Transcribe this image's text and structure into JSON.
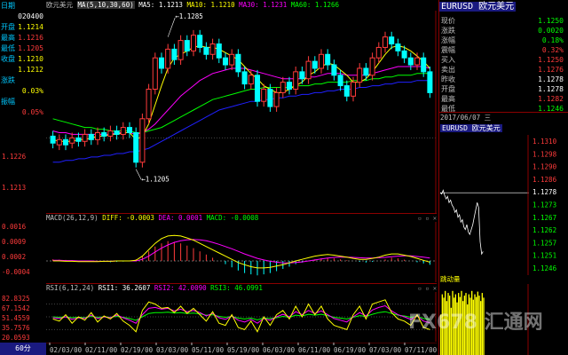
{
  "colors": {
    "bg": "#000000",
    "up": "#ff3b3b",
    "down": "#00ffff",
    "ma5": "#ffffff",
    "ma10": "#ffff00",
    "ma30": "#ff00ff",
    "ma60": "#00ff00",
    "ma_extra": "#2020ff",
    "label_cyan": "#00c8ff",
    "border_red": "#8b0000"
  },
  "left_panel": {
    "rows": [
      {
        "label": "日期",
        "value": "",
        "color": "#00c8ff"
      },
      {
        "label": "",
        "value": "020400",
        "color": "#ffffff"
      },
      {
        "label": "开盘",
        "value": "1.1214",
        "color": "#ffff00"
      },
      {
        "label": "最高",
        "value": "1.1216",
        "color": "#ff3b3b"
      },
      {
        "label": "最低",
        "value": "1.1205",
        "color": "#ff3b3b"
      },
      {
        "label": "收盘",
        "value": "1.1210",
        "color": "#ffff00"
      },
      {
        "label": "",
        "value": "1.1212",
        "color": "#ffff00"
      },
      {
        "label": "涨跌",
        "value": "",
        "color": "#00c8ff"
      },
      {
        "label": "",
        "value": "0.03%",
        "color": "#ffff00"
      },
      {
        "label": "振幅",
        "value": "",
        "color": "#00c8ff"
      },
      {
        "label": "",
        "value": "0.05%",
        "color": "#ff3b3b"
      }
    ],
    "price_ticks": [
      "1.1226",
      "1.1213"
    ],
    "macd_ticks": [
      "0.0016",
      "0.0009",
      "0.0002",
      "-0.0004"
    ],
    "rsi_ticks": [
      "82.8325",
      "67.1542",
      "51.4559",
      "35.7576",
      "20.0593"
    ]
  },
  "main": {
    "header": {
      "symbol": "欧元美元",
      "ma_label": "MA(5,10,30,60)",
      "ma5": "MA5: 1.1213",
      "ma10": "MA10: 1.1210",
      "ma30": "MA30: 1.1231",
      "ma60": "MA60: 1.1266"
    },
    "annot_high": "1.1285",
    "annot_low": "1.1205",
    "chart_data": {
      "type": "candlestick",
      "candles": [
        {
          "o": 0.35,
          "c": 0.31
        },
        {
          "o": 0.3,
          "c": 0.33
        },
        {
          "o": 0.33,
          "c": 0.3
        },
        {
          "o": 0.31,
          "c": 0.34
        },
        {
          "o": 0.34,
          "c": 0.32
        },
        {
          "o": 0.32,
          "c": 0.36
        },
        {
          "o": 0.36,
          "c": 0.33
        },
        {
          "o": 0.33,
          "c": 0.37
        },
        {
          "o": 0.37,
          "c": 0.35
        },
        {
          "o": 0.35,
          "c": 0.38
        },
        {
          "o": 0.38,
          "c": 0.36
        },
        {
          "o": 0.36,
          "c": 0.4
        },
        {
          "o": 0.4,
          "c": 0.37
        },
        {
          "o": 0.37,
          "c": 0.2
        },
        {
          "o": 0.2,
          "c": 0.45
        },
        {
          "o": 0.45,
          "c": 0.62
        },
        {
          "o": 0.62,
          "c": 0.8
        },
        {
          "o": 0.8,
          "c": 0.74
        },
        {
          "o": 0.74,
          "c": 0.85
        },
        {
          "o": 0.85,
          "c": 0.79
        },
        {
          "o": 0.79,
          "c": 0.9
        },
        {
          "o": 0.9,
          "c": 0.84
        },
        {
          "o": 0.84,
          "c": 0.93
        },
        {
          "o": 0.93,
          "c": 0.86
        },
        {
          "o": 0.86,
          "c": 0.82
        },
        {
          "o": 0.82,
          "c": 0.88
        },
        {
          "o": 0.88,
          "c": 0.8
        },
        {
          "o": 0.8,
          "c": 0.76
        },
        {
          "o": 0.76,
          "c": 0.82
        },
        {
          "o": 0.82,
          "c": 0.72
        },
        {
          "o": 0.72,
          "c": 0.65
        },
        {
          "o": 0.65,
          "c": 0.7
        },
        {
          "o": 0.7,
          "c": 0.55
        },
        {
          "o": 0.55,
          "c": 0.62
        },
        {
          "o": 0.62,
          "c": 0.52
        },
        {
          "o": 0.52,
          "c": 0.6
        },
        {
          "o": 0.6,
          "c": 0.66
        },
        {
          "o": 0.66,
          "c": 0.62
        },
        {
          "o": 0.62,
          "c": 0.72
        },
        {
          "o": 0.72,
          "c": 0.68
        },
        {
          "o": 0.68,
          "c": 0.78
        },
        {
          "o": 0.78,
          "c": 0.74
        },
        {
          "o": 0.74,
          "c": 0.82
        },
        {
          "o": 0.82,
          "c": 0.76
        },
        {
          "o": 0.76,
          "c": 0.7
        },
        {
          "o": 0.7,
          "c": 0.64
        },
        {
          "o": 0.64,
          "c": 0.58
        },
        {
          "o": 0.58,
          "c": 0.66
        },
        {
          "o": 0.66,
          "c": 0.74
        },
        {
          "o": 0.74,
          "c": 0.7
        },
        {
          "o": 0.7,
          "c": 0.8
        },
        {
          "o": 0.8,
          "c": 0.86
        },
        {
          "o": 0.86,
          "c": 0.92
        },
        {
          "o": 0.92,
          "c": 0.88
        },
        {
          "o": 0.88,
          "c": 0.84
        },
        {
          "o": 0.84,
          "c": 0.8
        },
        {
          "o": 0.8,
          "c": 0.76
        },
        {
          "o": 0.76,
          "c": 0.8
        },
        {
          "o": 0.8,
          "c": 0.72
        },
        {
          "o": 0.72,
          "c": 0.6
        }
      ],
      "ma5": [
        0.33,
        0.32,
        0.32,
        0.32,
        0.33,
        0.33,
        0.34,
        0.35,
        0.35,
        0.36,
        0.36,
        0.37,
        0.37,
        0.33,
        0.35,
        0.42,
        0.53,
        0.64,
        0.74,
        0.8,
        0.82,
        0.84,
        0.86,
        0.87,
        0.86,
        0.86,
        0.85,
        0.83,
        0.81,
        0.79,
        0.75,
        0.71,
        0.68,
        0.64,
        0.62,
        0.6,
        0.6,
        0.62,
        0.64,
        0.66,
        0.7,
        0.72,
        0.75,
        0.77,
        0.76,
        0.73,
        0.7,
        0.66,
        0.66,
        0.68,
        0.72,
        0.77,
        0.82,
        0.86,
        0.87,
        0.86,
        0.84,
        0.81,
        0.78,
        0.74
      ],
      "ma30": [
        0.38,
        0.37,
        0.37,
        0.36,
        0.36,
        0.36,
        0.36,
        0.36,
        0.36,
        0.36,
        0.37,
        0.37,
        0.37,
        0.36,
        0.37,
        0.39,
        0.42,
        0.46,
        0.5,
        0.54,
        0.58,
        0.61,
        0.64,
        0.67,
        0.69,
        0.71,
        0.72,
        0.73,
        0.74,
        0.74,
        0.74,
        0.73,
        0.72,
        0.71,
        0.7,
        0.69,
        0.68,
        0.68,
        0.68,
        0.68,
        0.69,
        0.69,
        0.7,
        0.71,
        0.71,
        0.71,
        0.7,
        0.7,
        0.7,
        0.7,
        0.71,
        0.72,
        0.73,
        0.74,
        0.75,
        0.75,
        0.75,
        0.75,
        0.75,
        0.74
      ],
      "ma60": [
        0.45,
        0.44,
        0.43,
        0.42,
        0.41,
        0.4,
        0.4,
        0.39,
        0.39,
        0.38,
        0.38,
        0.38,
        0.38,
        0.37,
        0.37,
        0.38,
        0.39,
        0.4,
        0.42,
        0.44,
        0.46,
        0.48,
        0.5,
        0.52,
        0.54,
        0.56,
        0.57,
        0.58,
        0.59,
        0.6,
        0.61,
        0.62,
        0.62,
        0.63,
        0.63,
        0.63,
        0.63,
        0.63,
        0.64,
        0.64,
        0.64,
        0.65,
        0.65,
        0.66,
        0.66,
        0.66,
        0.66,
        0.67,
        0.67,
        0.67,
        0.68,
        0.68,
        0.69,
        0.69,
        0.7,
        0.7,
        0.7,
        0.71,
        0.71,
        0.71
      ],
      "maext": [
        0.2,
        0.2,
        0.21,
        0.21,
        0.22,
        0.22,
        0.23,
        0.23,
        0.24,
        0.24,
        0.25,
        0.25,
        0.26,
        0.26,
        0.27,
        0.28,
        0.3,
        0.32,
        0.34,
        0.36,
        0.38,
        0.4,
        0.42,
        0.44,
        0.46,
        0.48,
        0.5,
        0.51,
        0.52,
        0.53,
        0.54,
        0.55,
        0.55,
        0.56,
        0.56,
        0.57,
        0.57,
        0.58,
        0.58,
        0.59,
        0.59,
        0.6,
        0.6,
        0.61,
        0.61,
        0.62,
        0.62,
        0.62,
        0.63,
        0.63,
        0.64,
        0.64,
        0.65,
        0.65,
        0.66,
        0.66,
        0.66,
        0.67,
        0.67,
        0.67
      ]
    }
  },
  "macd": {
    "label": "MACD(26,12,9)",
    "diff": "DIFF: -0.0003",
    "dea": "DEA: 0.0001",
    "macd": "MACD: -0.0008",
    "chart_data": {
      "type": "bar",
      "hist": [
        0.05,
        0.04,
        0.03,
        0.02,
        0.01,
        0.0,
        -0.01,
        -0.02,
        -0.03,
        -0.04,
        -0.03,
        -0.02,
        -0.01,
        0.05,
        0.15,
        0.3,
        0.45,
        0.55,
        0.62,
        0.6,
        0.55,
        0.48,
        0.4,
        0.3,
        0.2,
        0.1,
        0.0,
        -0.1,
        -0.2,
        -0.3,
        -0.38,
        -0.42,
        -0.45,
        -0.42,
        -0.38,
        -0.32,
        -0.25,
        -0.18,
        -0.1,
        -0.05,
        0.0,
        0.05,
        0.08,
        0.1,
        0.08,
        0.05,
        0.02,
        0.0,
        -0.03,
        -0.05,
        -0.03,
        0.0,
        0.05,
        0.1,
        0.08,
        0.04,
        0.0,
        -0.04,
        -0.08,
        -0.12
      ],
      "diff": [
        0.0,
        0.0,
        -0.01,
        -0.01,
        -0.02,
        -0.02,
        -0.02,
        -0.02,
        -0.01,
        -0.01,
        0.0,
        0.0,
        0.0,
        0.02,
        0.15,
        0.35,
        0.55,
        0.7,
        0.78,
        0.8,
        0.78,
        0.72,
        0.65,
        0.55,
        0.45,
        0.35,
        0.25,
        0.15,
        0.05,
        -0.05,
        -0.12,
        -0.18,
        -0.22,
        -0.22,
        -0.2,
        -0.16,
        -0.12,
        -0.06,
        0.0,
        0.05,
        0.1,
        0.15,
        0.18,
        0.2,
        0.18,
        0.15,
        0.12,
        0.08,
        0.05,
        0.05,
        0.08,
        0.12,
        0.18,
        0.22,
        0.22,
        0.18,
        0.14,
        0.08,
        0.02,
        -0.04
      ],
      "dea": [
        0.02,
        0.02,
        0.01,
        0.01,
        0.0,
        0.0,
        0.0,
        -0.01,
        -0.01,
        -0.01,
        0.0,
        0.0,
        0.0,
        0.0,
        0.05,
        0.15,
        0.28,
        0.4,
        0.5,
        0.58,
        0.63,
        0.66,
        0.67,
        0.66,
        0.63,
        0.58,
        0.52,
        0.45,
        0.38,
        0.3,
        0.22,
        0.15,
        0.08,
        0.03,
        -0.01,
        -0.04,
        -0.06,
        -0.06,
        -0.05,
        -0.03,
        0.0,
        0.03,
        0.06,
        0.09,
        0.11,
        0.12,
        0.12,
        0.11,
        0.1,
        0.09,
        0.09,
        0.1,
        0.11,
        0.13,
        0.15,
        0.16,
        0.16,
        0.14,
        0.12,
        0.09
      ]
    }
  },
  "rsi": {
    "label": "RSI(6,12,24)",
    "rsi1": "RSI1: 36.2607",
    "rsi2": "RSI2: 42.0090",
    "rsi3": "RSI3: 46.0991",
    "chart_data": {
      "type": "line",
      "rsi1": [
        0.45,
        0.4,
        0.55,
        0.35,
        0.5,
        0.42,
        0.6,
        0.38,
        0.52,
        0.45,
        0.58,
        0.4,
        0.3,
        0.15,
        0.65,
        0.85,
        0.8,
        0.7,
        0.72,
        0.6,
        0.75,
        0.58,
        0.7,
        0.55,
        0.4,
        0.62,
        0.35,
        0.3,
        0.55,
        0.25,
        0.2,
        0.4,
        0.15,
        0.5,
        0.3,
        0.55,
        0.65,
        0.45,
        0.75,
        0.5,
        0.8,
        0.55,
        0.75,
        0.45,
        0.3,
        0.25,
        0.2,
        0.55,
        0.75,
        0.45,
        0.8,
        0.85,
        0.9,
        0.6,
        0.45,
        0.4,
        0.3,
        0.55,
        0.25,
        0.2
      ],
      "rsi2": [
        0.48,
        0.46,
        0.5,
        0.44,
        0.48,
        0.46,
        0.54,
        0.46,
        0.5,
        0.48,
        0.54,
        0.48,
        0.42,
        0.35,
        0.55,
        0.7,
        0.72,
        0.68,
        0.7,
        0.64,
        0.68,
        0.62,
        0.65,
        0.6,
        0.52,
        0.58,
        0.48,
        0.44,
        0.52,
        0.42,
        0.38,
        0.44,
        0.35,
        0.46,
        0.42,
        0.5,
        0.56,
        0.5,
        0.62,
        0.55,
        0.65,
        0.58,
        0.64,
        0.55,
        0.46,
        0.42,
        0.38,
        0.5,
        0.6,
        0.52,
        0.66,
        0.72,
        0.76,
        0.64,
        0.55,
        0.5,
        0.44,
        0.52,
        0.4,
        0.36
      ],
      "rsi3": [
        0.5,
        0.49,
        0.5,
        0.48,
        0.49,
        0.48,
        0.51,
        0.49,
        0.5,
        0.49,
        0.51,
        0.49,
        0.46,
        0.42,
        0.5,
        0.58,
        0.6,
        0.6,
        0.61,
        0.59,
        0.6,
        0.58,
        0.59,
        0.57,
        0.54,
        0.55,
        0.51,
        0.49,
        0.51,
        0.47,
        0.45,
        0.47,
        0.43,
        0.47,
        0.46,
        0.48,
        0.51,
        0.49,
        0.54,
        0.52,
        0.56,
        0.54,
        0.56,
        0.53,
        0.49,
        0.47,
        0.45,
        0.49,
        0.53,
        0.51,
        0.56,
        0.6,
        0.62,
        0.58,
        0.54,
        0.52,
        0.49,
        0.51,
        0.46,
        0.44
      ]
    }
  },
  "xaxis": [
    "02/03/00",
    "02/11/00",
    "02/19/00",
    "03/03/00",
    "05/11/00",
    "05/19/00",
    "06/03/00",
    "06/11/00",
    "06/19/00",
    "07/03/00",
    "07/11/00"
  ],
  "period_button": "60分",
  "right_panel": {
    "title": "EURUSD 欧元美元",
    "rows": [
      {
        "label": "现价",
        "value": "1.1250",
        "color": "#00ff00"
      },
      {
        "label": "涨跌",
        "value": "0.0020",
        "color": "#00ff00"
      },
      {
        "label": "涨幅",
        "value": "0.18%",
        "color": "#00ff00"
      },
      {
        "label": "震幅",
        "value": "0.32%",
        "color": "#ff3b3b"
      },
      {
        "label": "买入",
        "value": "1.1250",
        "color": "#ff3b3b"
      },
      {
        "label": "卖出",
        "value": "1.1276",
        "color": "#ff3b3b"
      },
      {
        "label": "昨收",
        "value": "1.1278",
        "color": "#ffffff"
      },
      {
        "label": "开盘",
        "value": "1.1278",
        "color": "#ffffff"
      },
      {
        "label": "最高",
        "value": "1.1282",
        "color": "#ff3b3b"
      },
      {
        "label": "最低",
        "value": "1.1246",
        "color": "#00ff00"
      }
    ],
    "date": "2017/06/07 三",
    "tick_title": "EURUSD 欧元美元",
    "tick_axis": [
      "1.1310",
      "1.1298",
      "1.1290",
      "1.1286",
      "1.1278",
      "1.1273",
      "1.1267",
      "1.1262",
      "1.1257",
      "1.1251",
      "1.1246"
    ],
    "tick_labels_colors": [
      "#ff3b3b",
      "#ff3b3b",
      "#ff3b3b",
      "#ff3b3b",
      "#ffffff",
      "#00ff00",
      "#00ff00",
      "#00ff00",
      "#00ff00",
      "#00ff00",
      "#00ff00"
    ],
    "tick_chart_data": {
      "type": "line",
      "prices": [
        0.6,
        0.59,
        0.62,
        0.58,
        0.55,
        0.57,
        0.52,
        0.54,
        0.5,
        0.48,
        0.44,
        0.46,
        0.4,
        0.42,
        0.36,
        0.38,
        0.32,
        0.3,
        0.34,
        0.28,
        0.26,
        0.3,
        0.34,
        0.4,
        0.46,
        0.52,
        0.48,
        0.2,
        0.1,
        0.12
      ],
      "baseline": 0.6
    },
    "vol_label": "跳动量",
    "vol_data": [
      0.6,
      0.9,
      0.85,
      0.95,
      0.8,
      0.92,
      0.88,
      0.7,
      0.95,
      0.85,
      0.9,
      0.78,
      0.92,
      0.86,
      0.95,
      0.8,
      0.88,
      0.92,
      0.75,
      0.9,
      0.85,
      0.95,
      0.82,
      0.9,
      0.86,
      0.94,
      0.88,
      0.8,
      0.92,
      0.85
    ]
  },
  "watermark": "FX678 汇通网"
}
